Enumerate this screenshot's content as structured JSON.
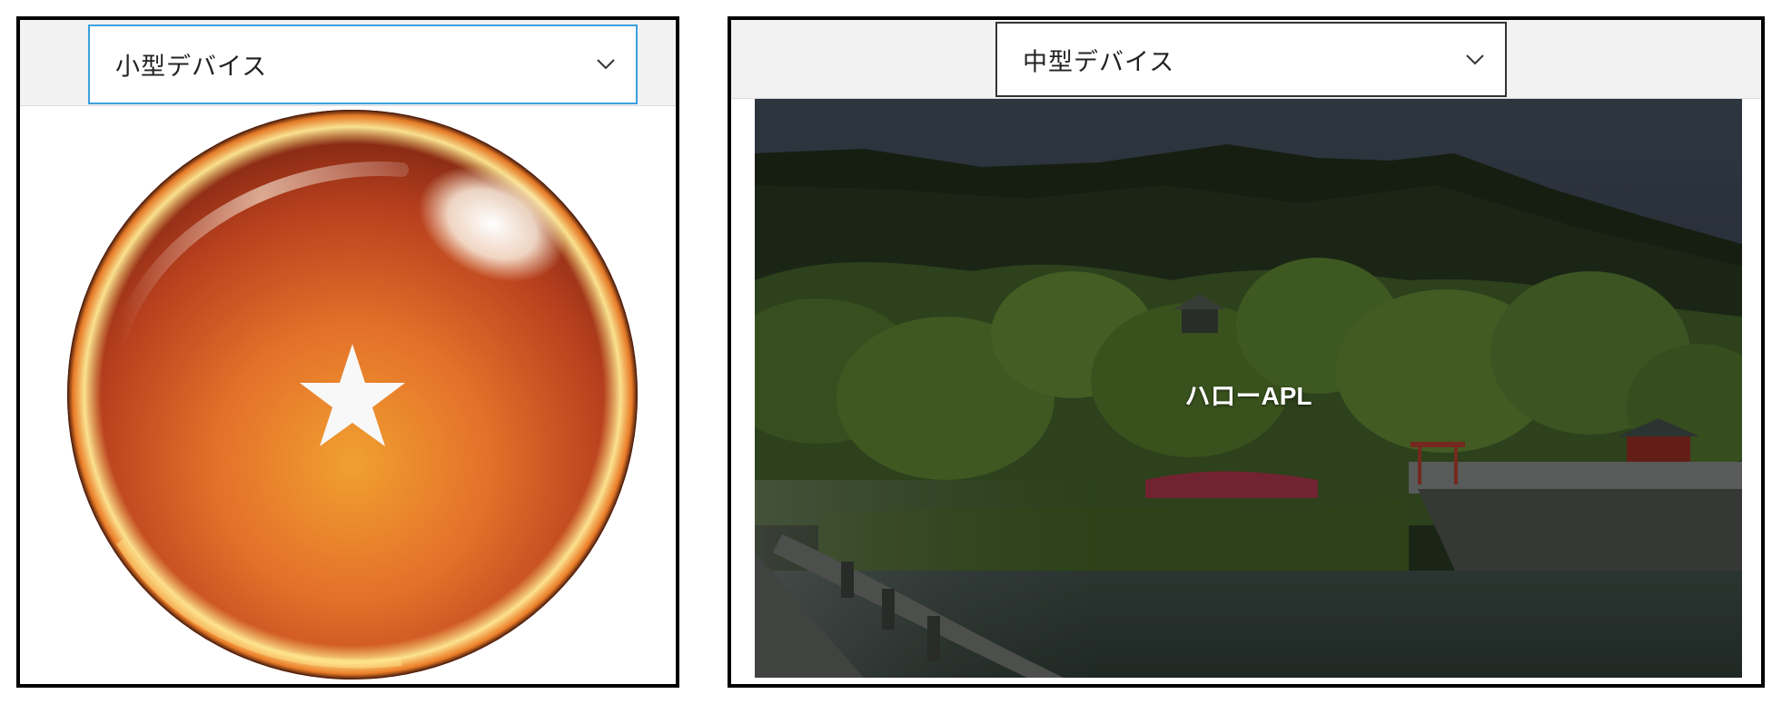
{
  "panels": {
    "small": {
      "dropdown": {
        "selected": "小型デバイス"
      }
    },
    "medium": {
      "dropdown": {
        "selected": "中型デバイス"
      },
      "caption": "ハローAPL"
    }
  },
  "icons": {
    "dropdown_chevron": "chevron-down-icon",
    "ball_star": "star-icon"
  },
  "colors": {
    "small_dropdown_border": "#3aa0e0",
    "medium_dropdown_border": "#333333",
    "toolbar_bg": "#f2f2f2",
    "ball_orange": "#e8742a",
    "star": "#f8f8f8"
  }
}
